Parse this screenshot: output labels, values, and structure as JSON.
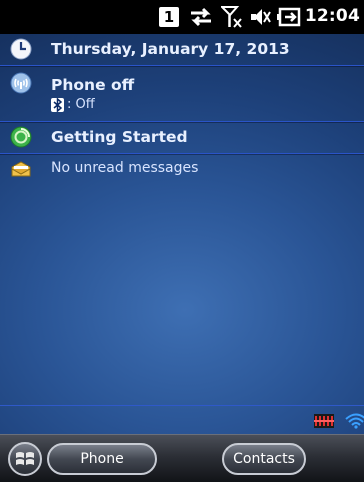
{
  "status_bar": {
    "sim_badge": "1",
    "time": "12:04",
    "icons": [
      "data-transfer-icon",
      "no-signal-icon",
      "volume-muted-icon",
      "battery-charging-icon"
    ]
  },
  "today": {
    "date": "Thursday, January 17, 2013",
    "phone": {
      "title": "Phone off",
      "bluetooth_status": ": Off"
    },
    "getting_started": "Getting Started",
    "messages": "No unread messages"
  },
  "softkeys": {
    "left": "Phone",
    "right": "Contacts"
  },
  "colors": {
    "background": "#2a5596",
    "row_divider": "#2a54c8",
    "status_bar": "#000000"
  }
}
